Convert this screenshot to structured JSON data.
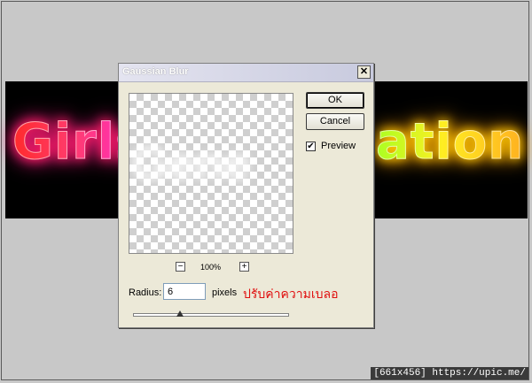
{
  "background_text": {
    "left": "Girls",
    "right": "ation"
  },
  "dialog": {
    "title": "Gaussian Blur",
    "close_glyph": "✕",
    "preview_text": "Gene",
    "zoom": {
      "minus": "−",
      "level": "100%",
      "plus": "+"
    },
    "ok_label": "OK",
    "cancel_label": "Cancel",
    "preview_checkbox": {
      "label": "Preview",
      "checked": true,
      "check_glyph": "✔"
    },
    "radius": {
      "label": "Radius:",
      "value": "6",
      "unit": "pixels",
      "slider_fraction": 0.3
    }
  },
  "annotation": "ปรับค่าความเบลอ",
  "watermark": "[661x456] https://upic.me/",
  "colors": {
    "annotation": "#e01010",
    "left_glow": "#ff2a6e",
    "right_glow": "#ffd020"
  },
  "icons": {
    "close": "close-icon",
    "zoom_out": "zoom-out-icon",
    "zoom_in": "zoom-in-icon",
    "check": "check-icon"
  }
}
